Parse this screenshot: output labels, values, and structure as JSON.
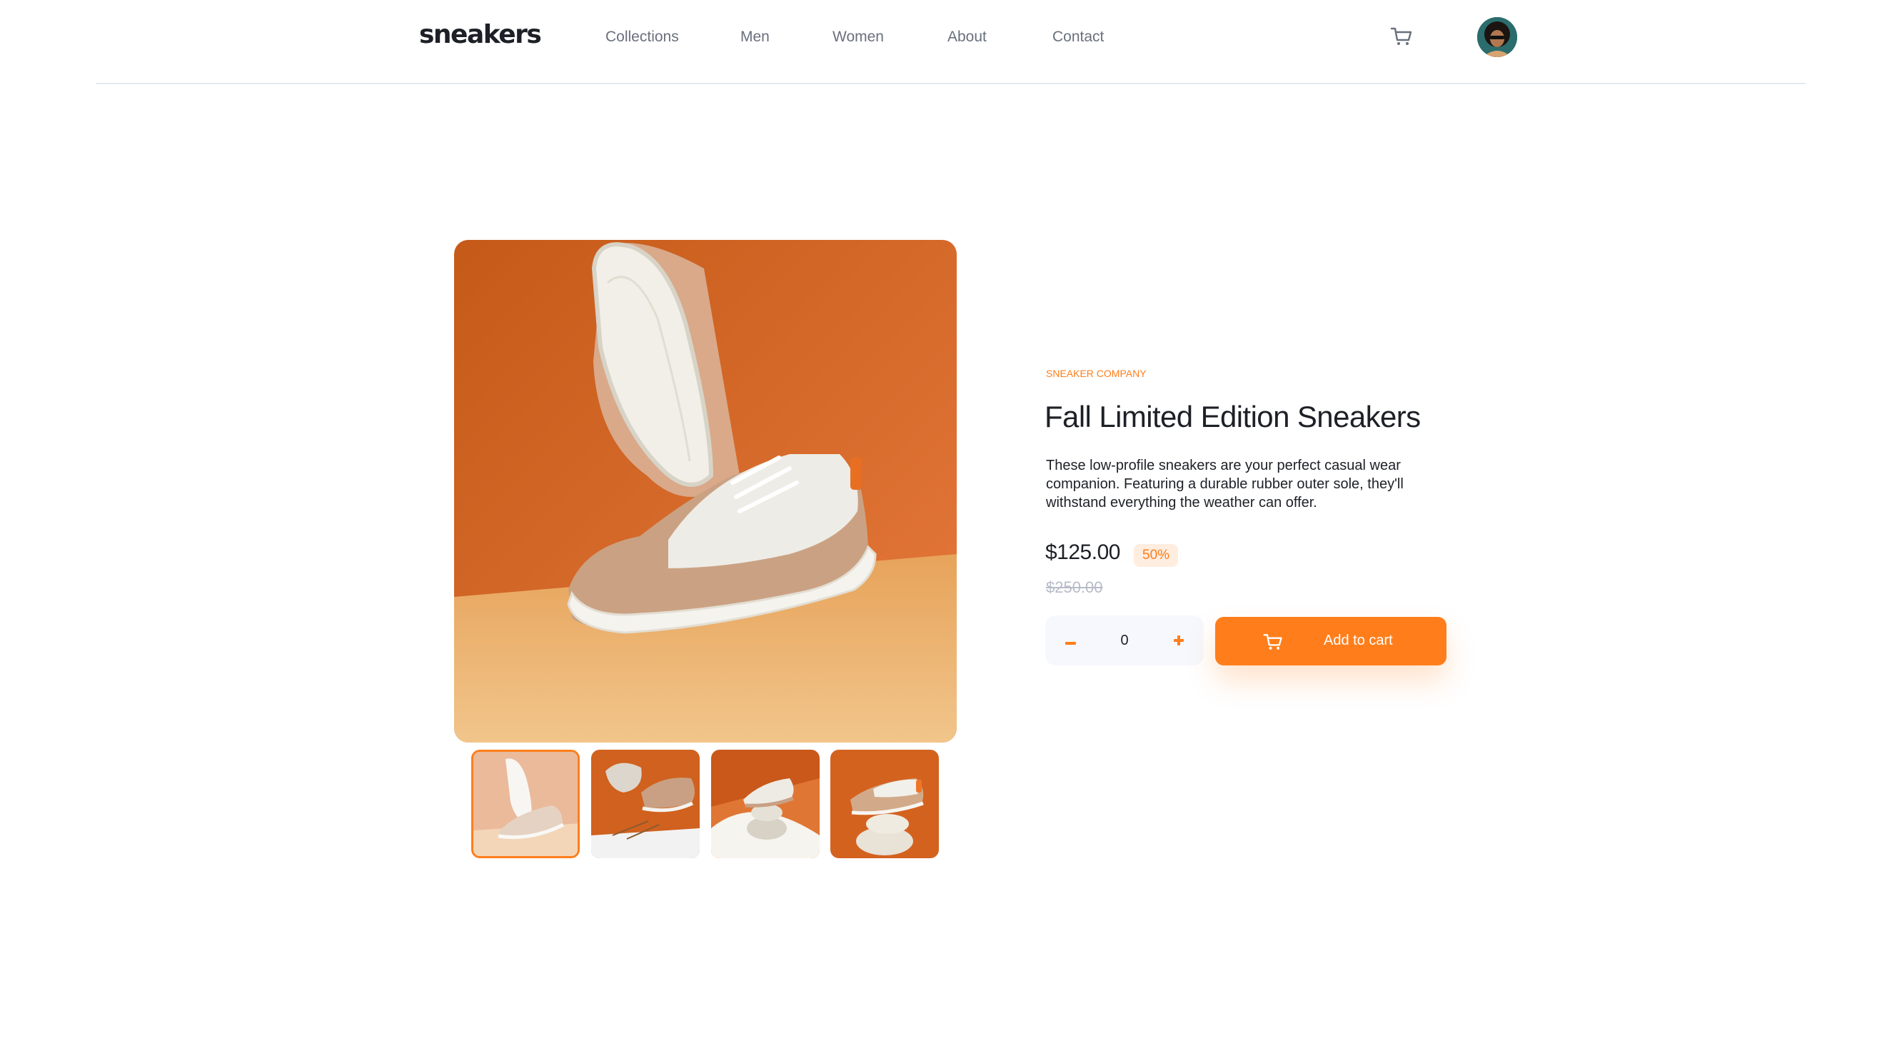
{
  "header": {
    "logo": "sneakers",
    "nav": [
      "Collections",
      "Men",
      "Women",
      "About",
      "Contact"
    ],
    "cart_icon": "cart-icon",
    "avatar_icon": "avatar"
  },
  "gallery": {
    "main_image": "white and tan sneaker with sole shown, orange background",
    "thumbnails": [
      "thumbnail-1",
      "thumbnail-2",
      "thumbnail-3",
      "thumbnail-4"
    ],
    "selected_thumbnail": 1
  },
  "product": {
    "company": "SNEAKER COMPANY",
    "title": "Fall Limited Edition Sneakers",
    "description": "These low-profile sneakers are your perfect casual wear companion. Featuring a durable rubber outer sole, they'll withstand everything the weather can offer.",
    "price": "$125.00",
    "discount": "50%",
    "old_price": "$250.00",
    "quantity": "0",
    "add_to_cart": "Add to cart"
  },
  "colors": {
    "accent": "#ff7e1b",
    "accent_pale": "#ffede0",
    "text_dark": "#1d2026",
    "text_gray": "#69707d"
  }
}
